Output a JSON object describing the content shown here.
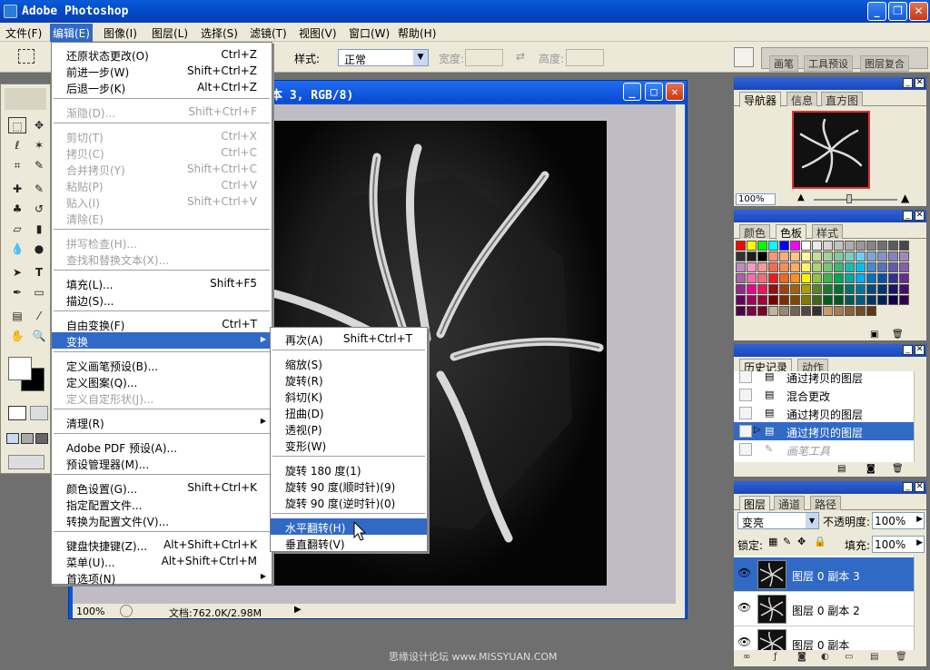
{
  "app": {
    "title": "Adobe Photoshop"
  },
  "menubar": [
    "文件(F)",
    "编辑(E)",
    "图像(I)",
    "图层(L)",
    "选择(S)",
    "滤镜(T)",
    "视图(V)",
    "窗口(W)",
    "帮助(H)"
  ],
  "options": {
    "style_label": "样式:",
    "style_value": "正常",
    "width_label": "宽度:",
    "height_label": "高度:",
    "palette_tabs": [
      "画笔",
      "工具预设",
      "图层复合"
    ]
  },
  "document": {
    "title": "本 3, RGB/8)",
    "zoom": "100%",
    "doc_info": "文档:762.0K/2.98M"
  },
  "edit_menu": [
    {
      "label": "还原状态更改(O)",
      "shortcut": "Ctrl+Z",
      "disabled": false
    },
    {
      "label": "前进一步(W)",
      "shortcut": "Shift+Ctrl+Z",
      "disabled": false
    },
    {
      "label": "后退一步(K)",
      "shortcut": "Alt+Ctrl+Z",
      "disabled": false
    },
    {
      "label": "渐隐(D)...",
      "shortcut": "Shift+Ctrl+F",
      "disabled": true
    },
    {
      "label": "剪切(T)",
      "shortcut": "Ctrl+X",
      "disabled": true
    },
    {
      "label": "拷贝(C)",
      "shortcut": "Ctrl+C",
      "disabled": true
    },
    {
      "label": "合并拷贝(Y)",
      "shortcut": "Shift+Ctrl+C",
      "disabled": true
    },
    {
      "label": "粘贴(P)",
      "shortcut": "Ctrl+V",
      "disabled": true
    },
    {
      "label": "贴入(I)",
      "shortcut": "Shift+Ctrl+V",
      "disabled": true
    },
    {
      "label": "清除(E)",
      "shortcut": "",
      "disabled": true
    },
    {
      "label": "拼写检查(H)...",
      "shortcut": "",
      "disabled": true
    },
    {
      "label": "查找和替换文本(X)...",
      "shortcut": "",
      "disabled": true
    },
    {
      "label": "填充(L)...",
      "shortcut": "Shift+F5",
      "disabled": false
    },
    {
      "label": "描边(S)...",
      "shortcut": "",
      "disabled": false
    },
    {
      "label": "自由变换(F)",
      "shortcut": "Ctrl+T",
      "disabled": false
    },
    {
      "label": "变换",
      "shortcut": "",
      "disabled": false
    },
    {
      "label": "定义画笔预设(B)...",
      "shortcut": "",
      "disabled": false
    },
    {
      "label": "定义图案(Q)...",
      "shortcut": "",
      "disabled": false
    },
    {
      "label": "定义自定形状(J)...",
      "shortcut": "",
      "disabled": true
    },
    {
      "label": "清理(R)",
      "shortcut": "",
      "disabled": false
    },
    {
      "label": "Adobe PDF 预设(A)...",
      "shortcut": "",
      "disabled": false
    },
    {
      "label": "预设管理器(M)...",
      "shortcut": "",
      "disabled": false
    },
    {
      "label": "颜色设置(G)...",
      "shortcut": "Shift+Ctrl+K",
      "disabled": false
    },
    {
      "label": "指定配置文件...",
      "shortcut": "",
      "disabled": false
    },
    {
      "label": "转换为配置文件(V)...",
      "shortcut": "",
      "disabled": false
    },
    {
      "label": "键盘快捷键(Z)...",
      "shortcut": "Alt+Shift+Ctrl+K",
      "disabled": false
    },
    {
      "label": "菜单(U)...",
      "shortcut": "Alt+Shift+Ctrl+M",
      "disabled": false
    },
    {
      "label": "首选项(N)",
      "shortcut": "",
      "disabled": false
    }
  ],
  "transform_menu": [
    {
      "label": "再次(A)",
      "shortcut": "Shift+Ctrl+T"
    },
    {
      "label": "缩放(S)",
      "shortcut": ""
    },
    {
      "label": "旋转(R)",
      "shortcut": ""
    },
    {
      "label": "斜切(K)",
      "shortcut": ""
    },
    {
      "label": "扭曲(D)",
      "shortcut": ""
    },
    {
      "label": "透视(P)",
      "shortcut": ""
    },
    {
      "label": "变形(W)",
      "shortcut": ""
    },
    {
      "label": "旋转 180 度(1)",
      "shortcut": ""
    },
    {
      "label": "旋转 90 度(顺时针)(9)",
      "shortcut": ""
    },
    {
      "label": "旋转 90 度(逆时针)(0)",
      "shortcut": ""
    },
    {
      "label": "水平翻转(H)",
      "shortcut": ""
    },
    {
      "label": "垂直翻转(V)",
      "shortcut": ""
    }
  ],
  "navigator": {
    "tabs": [
      "导航器",
      "信息",
      "直方图"
    ],
    "zoom": "100%"
  },
  "swatches": {
    "tabs": [
      "颜色",
      "色板",
      "样式"
    ]
  },
  "history": {
    "tabs": [
      "历史记录",
      "动作"
    ],
    "items": [
      "通过拷贝的图层",
      "混合更改",
      "通过拷贝的图层",
      "通过拷贝的图层",
      "画笔工具"
    ]
  },
  "layers": {
    "tabs": [
      "图层",
      "通道",
      "路径"
    ],
    "blend": "变亮",
    "opacity_label": "不透明度:",
    "opacity": "100%",
    "lock_label": "锁定:",
    "fill_label": "填充:",
    "fill": "100%",
    "items": [
      "图层 0 副本 3",
      "图层 0 副本 2",
      "图层 0 副本"
    ]
  },
  "watermark": "思缘设计论坛 www.MISSYUAN.COM"
}
